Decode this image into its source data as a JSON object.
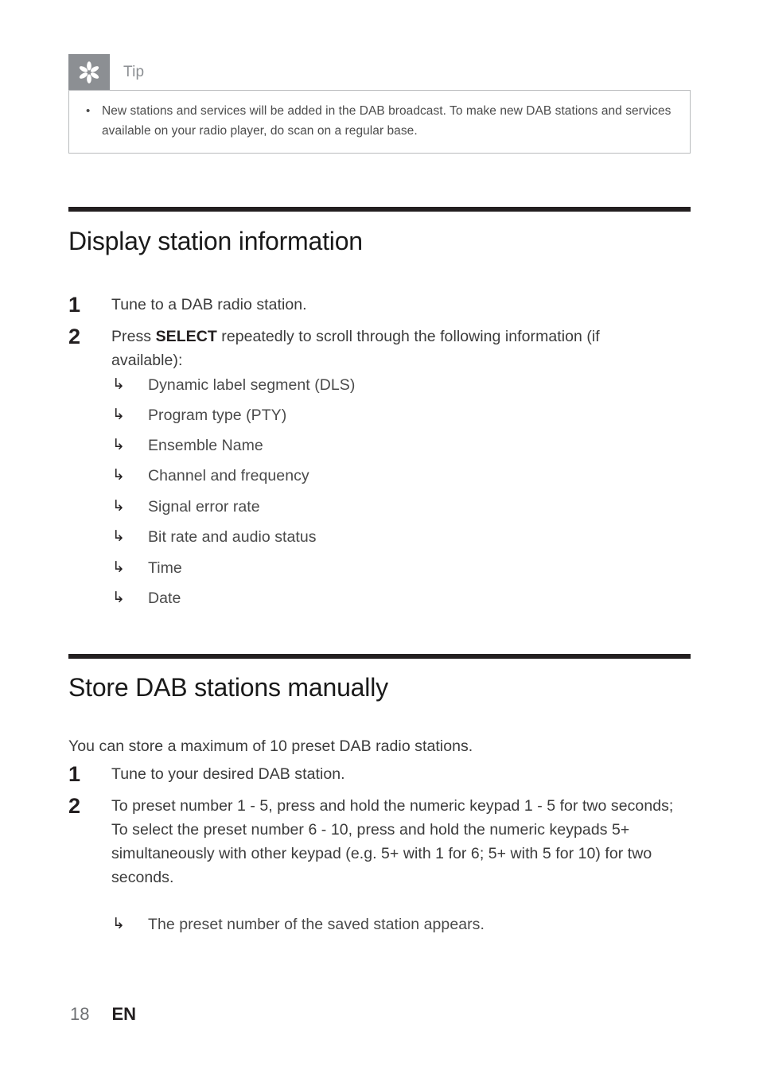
{
  "tip": {
    "icon": "asterisk-flower-icon",
    "title": "Tip",
    "bullet_marker": "•",
    "items": [
      "New stations and services will be added in the DAB broadcast. To make new DAB stations and services available on your radio player, do scan on a regular base."
    ]
  },
  "sections": [
    {
      "heading": "Display station information",
      "steps": [
        {
          "number": "1",
          "text_before": "Tune to a DAB radio station.",
          "bold": "",
          "text_after": ""
        },
        {
          "number": "2",
          "text_before": "Press ",
          "bold": "SELECT",
          "text_after": " repeatedly to scroll through the following information (if available):"
        }
      ],
      "arrow_marker": "↳",
      "arrow_items": [
        "Dynamic label segment (DLS)",
        "Program type (PTY)",
        "Ensemble Name",
        "Channel and frequency",
        "Signal error rate",
        "Bit rate and audio status",
        "Time",
        "Date"
      ]
    },
    {
      "heading": "Store DAB stations manually",
      "intro": "You can store a maximum of 10 preset DAB radio stations.",
      "steps": [
        {
          "number": "1",
          "text": "Tune to your desired DAB station."
        },
        {
          "number": "2",
          "text": "To preset number 1 - 5, press and hold the numeric keypad 1 - 5 for two seconds;\nTo select the preset number 6 - 10, press and hold the numeric keypads 5+ simultaneously with other keypad (e.g. 5+ with 1 for 6; 5+ with 5 for 10) for two seconds."
        }
      ],
      "arrow_marker": "↳",
      "arrow_items": [
        "The preset number of the saved station appears."
      ]
    }
  ],
  "footer": {
    "page_number": "18",
    "language": "EN"
  },
  "colors": {
    "tip_gray": "#8c8f93",
    "rule_black": "#231f20",
    "body_text": "#3b3b3b",
    "tip_text": "#4c4c4c",
    "footer_page": "#6e7073"
  }
}
